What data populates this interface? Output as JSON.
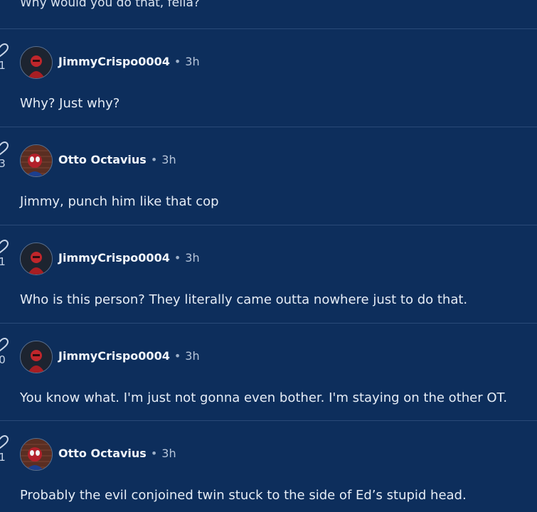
{
  "feed": {
    "top_partial_text": "Why would you do that, fella?",
    "comments": [
      {
        "username": "JimmyCrispo0004",
        "separator": "•",
        "time": "3h",
        "likes": "1",
        "text": "Why? Just why?",
        "avatar_icon": "red-hooded-avatar-icon"
      },
      {
        "username": "Otto Octavius",
        "separator": "•",
        "time": "3h",
        "likes": "3",
        "text": "Jimmy, punch him like that cop",
        "avatar_icon": "spider-man-brick-avatar-icon"
      },
      {
        "username": "JimmyCrispo0004",
        "separator": "•",
        "time": "3h",
        "likes": "1",
        "text": "Who is this person? They literally came outta nowhere just to do that.",
        "avatar_icon": "red-hooded-avatar-icon"
      },
      {
        "username": "JimmyCrispo0004",
        "separator": "•",
        "time": "3h",
        "likes": "0",
        "text": "You know what. I'm just not gonna even bother. I'm staying on the other OT.",
        "avatar_icon": "red-hooded-avatar-icon"
      },
      {
        "username": "Otto Octavius",
        "separator": "•",
        "time": "3h",
        "likes": "1",
        "text": "Probably the evil conjoined twin stuck to the side of Ed’s stupid head.",
        "avatar_icon": "spider-man-brick-avatar-icon"
      }
    ]
  },
  "colors": {
    "background": "#0d2e5c",
    "divider": "#2a4a78",
    "text": "#e6edf6"
  }
}
